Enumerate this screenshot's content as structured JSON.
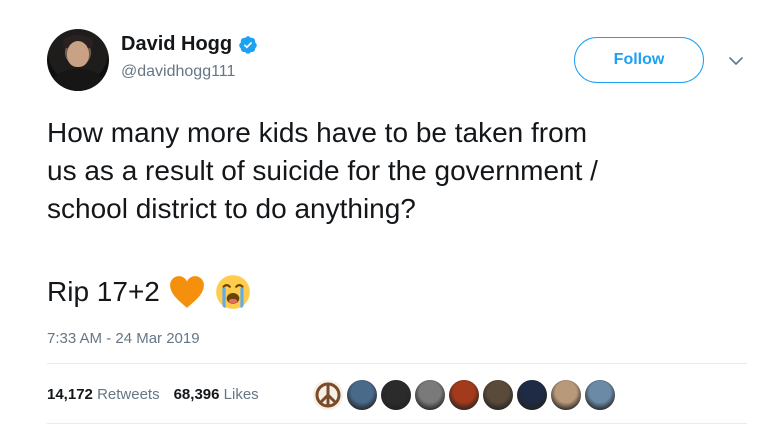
{
  "author": {
    "display_name": "David Hogg",
    "handle": "@davidhogg111",
    "verified": true
  },
  "follow_button": {
    "label": "Follow"
  },
  "tweet": {
    "text": "How many more kids have to be taken from\nus as a result of suicide for the government /\nschool district to do anything?",
    "rip_text": "Rip 17+2",
    "emojis": [
      "orange-heart",
      "loudly-crying-face"
    ],
    "timestamp": "7:33 AM - 24 Mar 2019"
  },
  "stats": {
    "retweets_count": "14,172",
    "retweets_label": "Retweets",
    "likes_count": "68,396",
    "likes_label": "Likes"
  },
  "likers": [
    {
      "name": "peace-sign-avatar",
      "color": "#d9c4a0"
    },
    {
      "name": "liker-avatar-2",
      "color": "#4a6a8a"
    },
    {
      "name": "liker-avatar-3",
      "color": "#2b2b2b"
    },
    {
      "name": "liker-avatar-4",
      "color": "#7a7a7a"
    },
    {
      "name": "liker-avatar-5",
      "color": "#a33a1c"
    },
    {
      "name": "liker-avatar-6",
      "color": "#5a4a3a"
    },
    {
      "name": "liker-avatar-7",
      "color": "#1f2a44"
    },
    {
      "name": "liker-avatar-8",
      "color": "#b89a7a"
    },
    {
      "name": "liker-avatar-9",
      "color": "#6b8aa6"
    }
  ],
  "colors": {
    "accent": "#1da1f2",
    "secondary_text": "#657786",
    "primary_text": "#14171a"
  }
}
